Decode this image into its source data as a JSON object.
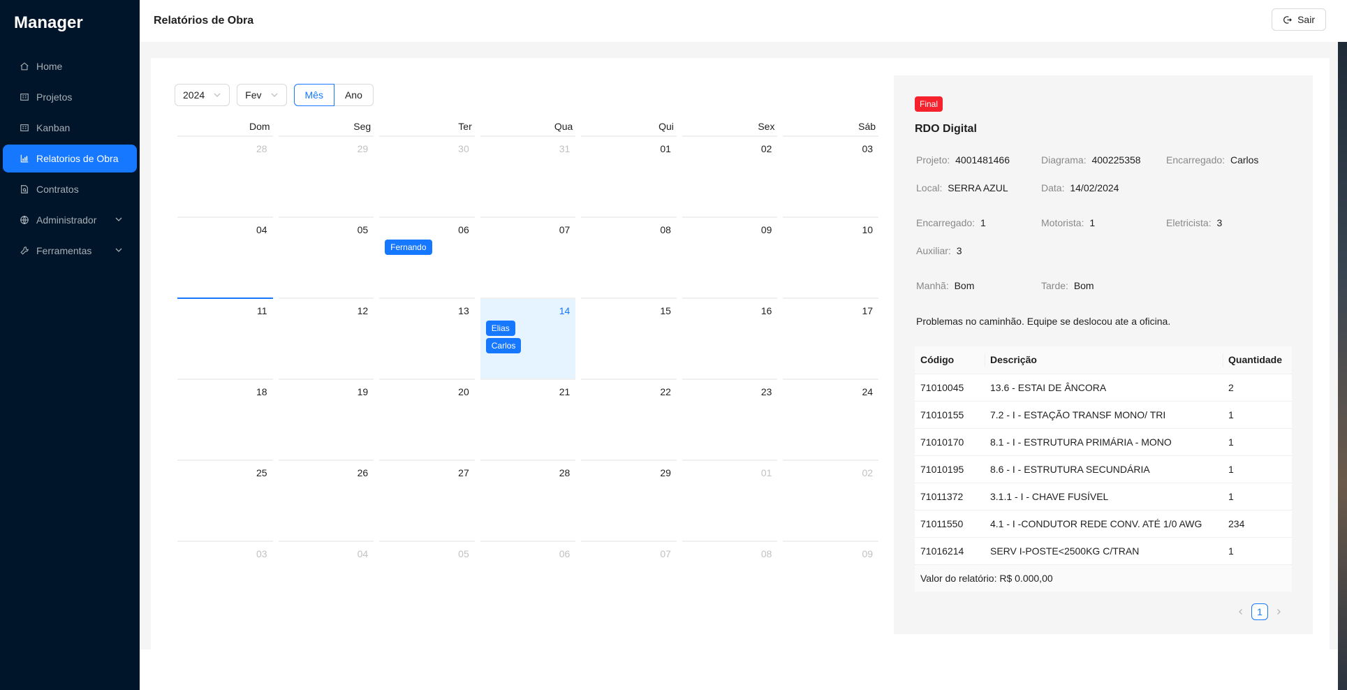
{
  "app": {
    "title": "Manager"
  },
  "sidebar": {
    "items": [
      {
        "label": "Home",
        "icon": "home-icon"
      },
      {
        "label": "Projetos",
        "icon": "building-icon"
      },
      {
        "label": "Kanban",
        "icon": "building-icon"
      },
      {
        "label": "Relatorios de Obra",
        "icon": "chart-icon",
        "active": true
      },
      {
        "label": "Contratos",
        "icon": "file-search-icon"
      },
      {
        "label": "Administrador",
        "icon": "globe-icon",
        "expandable": true
      },
      {
        "label": "Ferramentas",
        "icon": "tool-icon",
        "expandable": true
      }
    ]
  },
  "header": {
    "title": "Relatórios de Obra",
    "logout_label": "Sair"
  },
  "calendar": {
    "year": "2024",
    "month": "Fev",
    "mode_month": "Mês",
    "mode_year": "Ano",
    "weekdays": [
      "Dom",
      "Seg",
      "Ter",
      "Qua",
      "Qui",
      "Sex",
      "Sáb"
    ],
    "weeks": [
      [
        {
          "d": "28",
          "m": true
        },
        {
          "d": "29",
          "m": true
        },
        {
          "d": "30",
          "m": true
        },
        {
          "d": "31",
          "m": true
        },
        {
          "d": "01"
        },
        {
          "d": "02"
        },
        {
          "d": "03"
        }
      ],
      [
        {
          "d": "04"
        },
        {
          "d": "05"
        },
        {
          "d": "06",
          "tags": [
            "Fernando"
          ]
        },
        {
          "d": "07"
        },
        {
          "d": "08"
        },
        {
          "d": "09"
        },
        {
          "d": "10"
        }
      ],
      [
        {
          "d": "11",
          "today": true
        },
        {
          "d": "12"
        },
        {
          "d": "13"
        },
        {
          "d": "14",
          "selected": true,
          "tags": [
            "Elias",
            "Carlos"
          ]
        },
        {
          "d": "15"
        },
        {
          "d": "16"
        },
        {
          "d": "17"
        }
      ],
      [
        {
          "d": "18"
        },
        {
          "d": "19"
        },
        {
          "d": "20"
        },
        {
          "d": "21"
        },
        {
          "d": "22"
        },
        {
          "d": "23"
        },
        {
          "d": "24"
        }
      ],
      [
        {
          "d": "25"
        },
        {
          "d": "26"
        },
        {
          "d": "27"
        },
        {
          "d": "28"
        },
        {
          "d": "29"
        },
        {
          "d": "01",
          "m": true
        },
        {
          "d": "02",
          "m": true
        }
      ],
      [
        {
          "d": "03",
          "m": true
        },
        {
          "d": "04",
          "m": true
        },
        {
          "d": "05",
          "m": true
        },
        {
          "d": "06",
          "m": true
        },
        {
          "d": "07",
          "m": true
        },
        {
          "d": "08",
          "m": true
        },
        {
          "d": "09",
          "m": true
        }
      ]
    ]
  },
  "report": {
    "status": "Final",
    "title": "RDO Digital",
    "projeto_label": "Projeto",
    "projeto": "4001481466",
    "diagrama_label": "Diagrama",
    "diagrama": "400225358",
    "encarregado_label": "Encarregado",
    "encarregado": "Carlos",
    "local_label": "Local",
    "local": "SERRA AZUL",
    "data_label": "Data",
    "data": "14/02/2024",
    "team": {
      "encarregado_label": "Encarregado",
      "encarregado": "1",
      "motorista_label": "Motorista",
      "motorista": "1",
      "eletricista_label": "Eletricista",
      "eletricista": "3",
      "auxiliar_label": "Auxiliar",
      "auxiliar": "3"
    },
    "weather": {
      "manha_label": "Manhã",
      "manha": "Bom",
      "tarde_label": "Tarde",
      "tarde": "Bom"
    },
    "note": "Problemas no caminhão. Equipe se deslocou ate a oficina.",
    "table": {
      "headers": [
        "Código",
        "Descrição",
        "Quantidade"
      ],
      "rows": [
        [
          "71010045",
          "13.6 - ESTAI DE ÂNCORA",
          "2"
        ],
        [
          "71010155",
          "7.2 - I - ESTAÇÃO TRANSF MONO/ TRI",
          "1"
        ],
        [
          "71010170",
          "8.1 - I - ESTRUTURA PRIMÁRIA - MONO",
          "1"
        ],
        [
          "71010195",
          "8.6 - I - ESTRUTURA SECUNDÁRIA",
          "1"
        ],
        [
          "71011372",
          "3.1.1 - I - CHAVE FUSÍVEL",
          "1"
        ],
        [
          "71011550",
          "4.1 - I -CONDUTOR REDE CONV. ATÉ 1/0 AWG",
          "234"
        ],
        [
          "71016214",
          "SERV I-POSTE<2500KG C/TRAN",
          "1"
        ]
      ],
      "summary": "Valor do relatório: R$ 0.000,00"
    },
    "pagination": {
      "current": "1"
    }
  },
  "colors": {
    "sidebar": "#001529",
    "accent": "#1677ff",
    "final": "#f5222d"
  }
}
